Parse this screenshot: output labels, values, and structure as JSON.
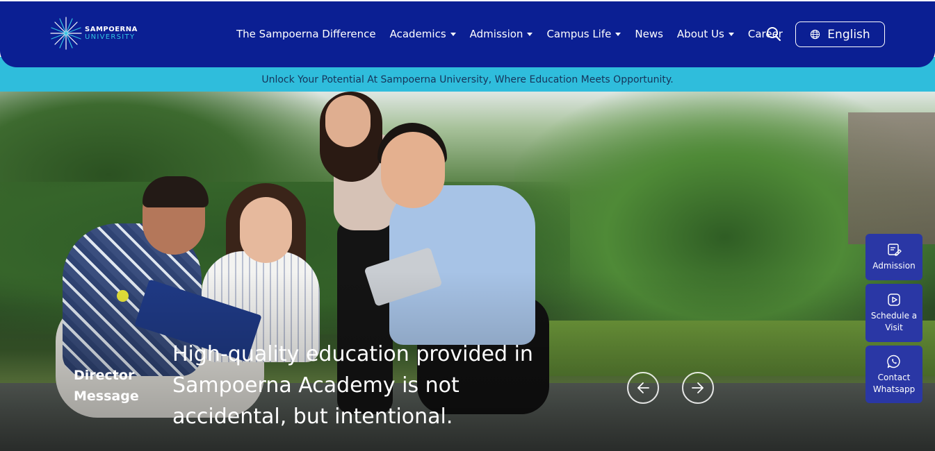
{
  "header": {
    "logo": {
      "name_top": "SAMPOERNA",
      "name_bottom": "UNIVERSITY",
      "icon": "starburst-logo-icon"
    },
    "nav": [
      {
        "label": "The Sampoerna Difference",
        "dropdown": false
      },
      {
        "label": "Academics",
        "dropdown": true
      },
      {
        "label": "Admission",
        "dropdown": true
      },
      {
        "label": "Campus Life",
        "dropdown": true
      },
      {
        "label": "News",
        "dropdown": false
      },
      {
        "label": "About Us",
        "dropdown": true
      },
      {
        "label": "Career",
        "dropdown": false
      }
    ],
    "search_icon": "search-icon",
    "language": {
      "label": "English",
      "icon": "globe-icon"
    }
  },
  "tagline": "Unlock Your Potential At Sampoerna University, Where Education Meets Opportunity.",
  "hero": {
    "section_label": "Director Message",
    "quote": "High-quality education provided in Sampoerna Academy is not accidental, but intentional.",
    "prev_icon": "arrow-left-icon",
    "next_icon": "arrow-right-icon"
  },
  "side_actions": [
    {
      "label": "Admission",
      "icon": "edit-form-icon"
    },
    {
      "label": "Schedule a Visit",
      "icon": "play-icon"
    },
    {
      "label": "Contact Whatsapp",
      "icon": "whatsapp-icon"
    }
  ],
  "colors": {
    "header_bg": "#0b1f93",
    "tagline_bg": "#2fbddc",
    "side_button_bg": "#2a37a5",
    "logo_accent": "#33c3e2"
  }
}
